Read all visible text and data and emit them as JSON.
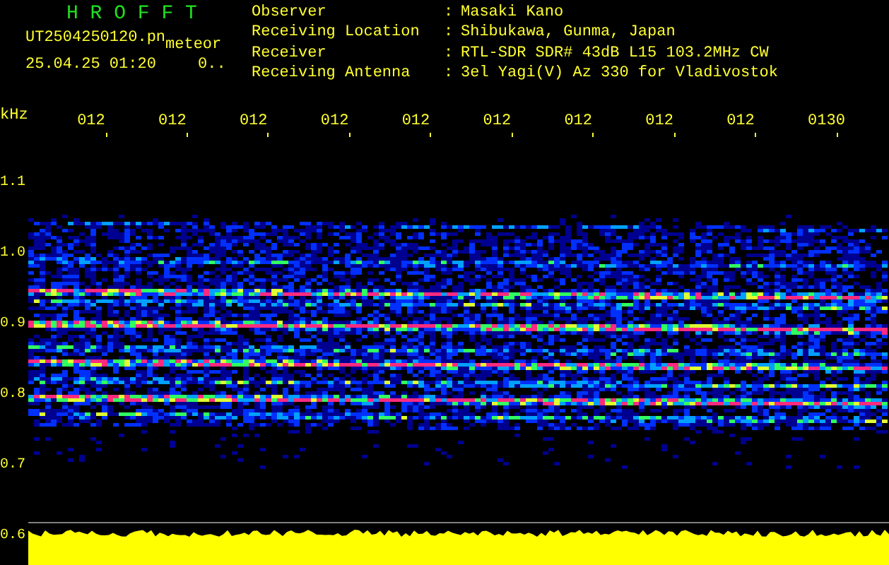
{
  "app_title": "H R O F F T",
  "file_name": "UT2504250120.pn",
  "file_tag": "meteor",
  "timestamp": "25.04.25 01:20",
  "count": "0..",
  "info": [
    {
      "label": "Observer",
      "separator": ":",
      "value": "Masaki Kano"
    },
    {
      "label": "Receiving Location",
      "separator": ":",
      "value": "Shibukawa, Gunma, Japan"
    },
    {
      "label": "Receiver",
      "separator": ":",
      "value": "RTL-SDR SDR# 43dB L15 103.2MHz CW"
    },
    {
      "label": "Receiving Antenna",
      "separator": ":",
      "value": "3el Yagi(V) Az 330 for Vladivostok"
    }
  ],
  "frequency_unit": "kHz",
  "time_axis": [
    "012",
    "012",
    "012",
    "012",
    "012",
    "012",
    "012",
    "012",
    "012",
    "0130"
  ],
  "frequency_axis": [
    "1.1",
    "1.0",
    "0.9",
    "0.8",
    "0.7",
    "0.6"
  ]
}
